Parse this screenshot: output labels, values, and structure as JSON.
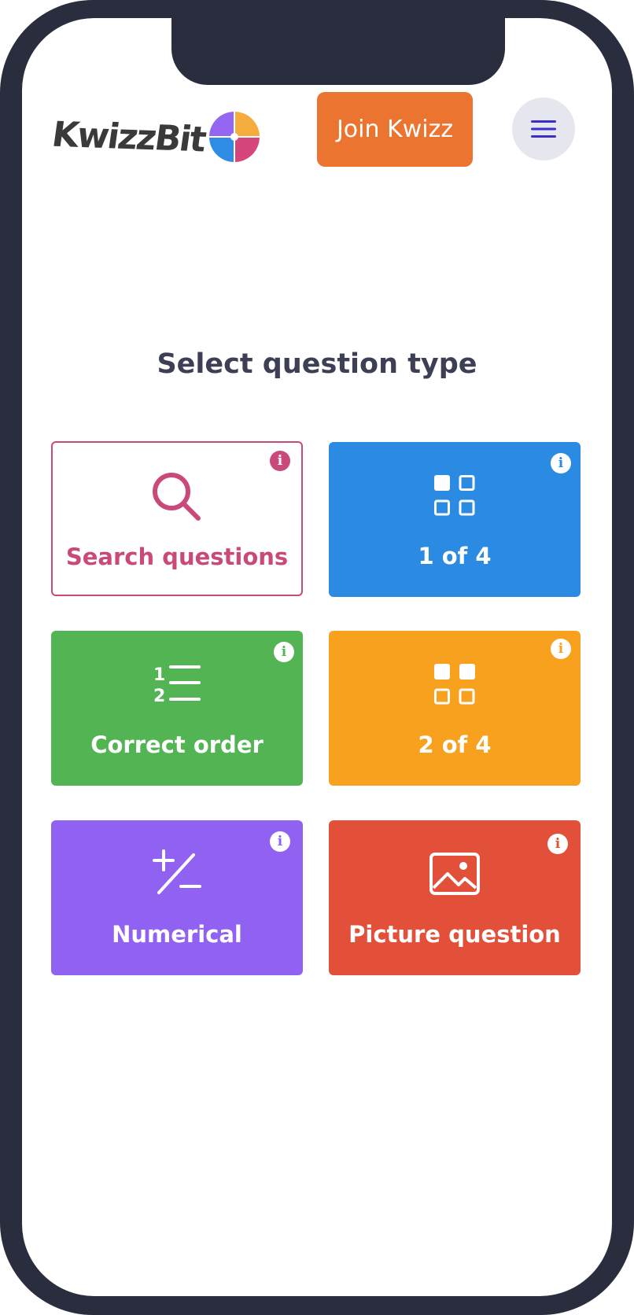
{
  "header": {
    "logo_text": "KwizzBit",
    "join_label": "Join Kwizz",
    "menu_icon": "hamburger-icon"
  },
  "main": {
    "title": "Select question type",
    "tiles": [
      {
        "label": "Search questions",
        "icon": "search-icon",
        "color": "#c94a7a",
        "info": "i"
      },
      {
        "label": "1 of 4",
        "icon": "grid-1-of-4-icon",
        "color": "#2b8be3",
        "info": "i"
      },
      {
        "label": "Correct order",
        "icon": "ordered-list-icon",
        "color": "#53b454",
        "info": "i"
      },
      {
        "label": "2 of 4",
        "icon": "grid-2-of-4-icon",
        "color": "#f7a11f",
        "info": "i"
      },
      {
        "label": "Numerical",
        "icon": "plus-minus-icon",
        "color": "#9161f2",
        "info": "i"
      },
      {
        "label": "Picture question",
        "icon": "image-icon",
        "color": "#e3503a",
        "info": "i"
      }
    ]
  },
  "colors": {
    "frame": "#2a2d3e",
    "join_button": "#ea7430",
    "menu_button_bg": "#e6e6ee",
    "menu_icon": "#3a2fc9",
    "title_text": "#3d3f55"
  }
}
